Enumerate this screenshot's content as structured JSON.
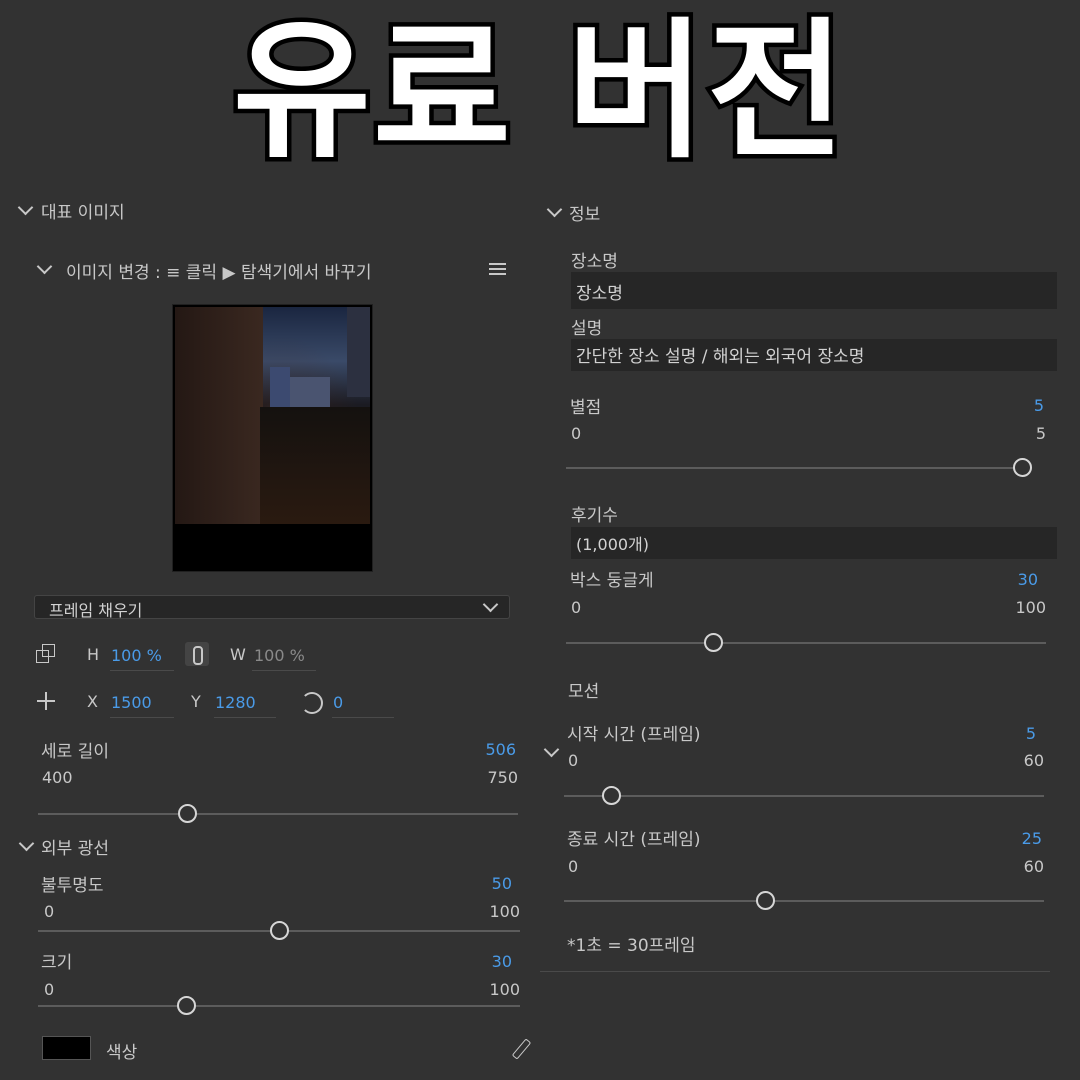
{
  "title": "유료 버전",
  "left": {
    "section_image": "대표 이미지",
    "image_change_label": "이미지 변경 : ≡ 클릭 ▶ 탐색기에서 바꾸기",
    "fill_mode": "프레임 채우기",
    "h_label": "H",
    "h_value": "100 %",
    "w_label": "W",
    "w_value": "100 %",
    "x_label": "X",
    "x_value": "1500",
    "y_label": "Y",
    "y_value": "1280",
    "rotation_value": "0",
    "height_slider": {
      "label": "세로 길이",
      "value": "506",
      "min": "400",
      "max": "750",
      "fraction": 0.303
    },
    "section_glow": "외부 광선",
    "opacity_slider": {
      "label": "불투명도",
      "value": "50",
      "min": "0",
      "max": "100",
      "fraction": 0.5
    },
    "size_slider": {
      "label": "크기",
      "value": "30",
      "min": "0",
      "max": "100",
      "fraction": 0.3
    },
    "color_label": "색상",
    "color_value": "#000000"
  },
  "right": {
    "section_info": "정보",
    "place_label": "장소명",
    "place_value": "장소명",
    "desc_label": "설명",
    "desc_value": "간단한 장소 설명 / 해외는 외국어 장소명",
    "rating_slider": {
      "label": "별점",
      "value": "5",
      "min": "0",
      "max": "5",
      "fraction": 1.0
    },
    "reviews_label": "후기수",
    "reviews_value": "(1,000개)",
    "radius_slider": {
      "label": "박스 둥글게",
      "value": "30",
      "min": "0",
      "max": "100",
      "fraction": 0.3
    },
    "motion_label": "모션",
    "start_slider": {
      "label": "시작 시간 (프레임)",
      "value": "5",
      "min": "0",
      "max": "60",
      "fraction": 0.083
    },
    "end_slider": {
      "label": "종료 시간 (프레임)",
      "value": "25",
      "min": "0",
      "max": "60",
      "fraction": 0.417
    },
    "note": "*1초 = 30프레임"
  },
  "colors": {
    "accent": "#4a9be8",
    "panel": "#323232",
    "field": "#262626"
  }
}
